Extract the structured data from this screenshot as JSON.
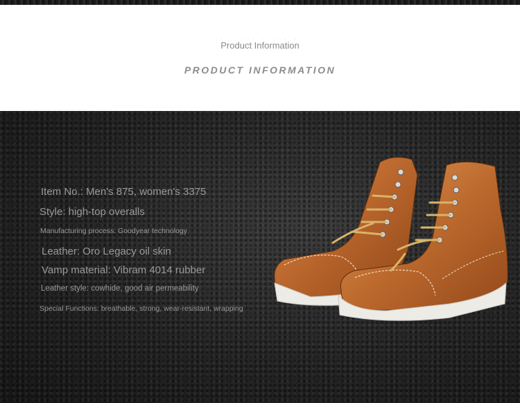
{
  "header": {
    "subtitle": "Product Information",
    "title": "PRODUCT INFORMATION"
  },
  "specs": [
    {
      "text": "Item No.: Men's 875, women's 3375"
    },
    {
      "text": "Style: high-top overalls"
    },
    {
      "text": "Manufacturing process: Goodyear technology"
    },
    {
      "text": "Leather: Oro Legacy oil skin"
    },
    {
      "text": "Vamp material: Vibram 4014 rubber"
    },
    {
      "text": "Leather style: cowhide, good air permeability"
    },
    {
      "text": "Special Functions: breathable, strong, wear-resistant, wrapping"
    }
  ],
  "colors": {
    "leather": "#b5622a",
    "leather_light": "#d88a47",
    "sole": "#ecebe6",
    "laces": "#d9b46a",
    "background_dark": "#252525",
    "text_gray": "#9a9a9a"
  },
  "image": {
    "name": "moc-toe-work-boots"
  }
}
